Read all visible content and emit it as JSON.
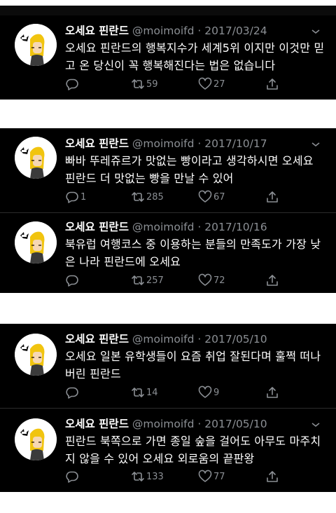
{
  "tweets": [
    {
      "name": "오세요 핀란드",
      "handle": "@moimoifd",
      "date": "· 2017/03/24",
      "text": "오세요 핀란드의 행복지수가 세계5위 이지만 이것만 믿고 온 당신이 꼭 행복해진다는 법은 없습니다",
      "replies": "",
      "retweets": "59",
      "likes": "27"
    },
    {
      "name": "오세요 핀란드",
      "handle": "@moimoifd",
      "date": "· 2017/10/17",
      "text": "빠바 뚜레쥬르가 맛없는 빵이라고 생각하시면 오세요 핀란드 더 맛없는 빵을 만날 수 있어",
      "replies": "1",
      "retweets": "285",
      "likes": "67"
    },
    {
      "name": "오세요 핀란드",
      "handle": "@moimoifd",
      "date": "· 2017/10/16",
      "text": "북유럽 여행코스 중 이용하는 분들의 만족도가 가장 낮은 나라 핀란드에 오세요",
      "replies": "",
      "retweets": "257",
      "likes": "72"
    },
    {
      "name": "오세요 핀란드",
      "handle": "@moimoifd",
      "date": "· 2017/05/10",
      "text": "오세요 일본 유학생들이 요즘 취업 잘된다며 훌쩍 떠나버린 핀란드",
      "replies": "",
      "retweets": "14",
      "likes": "9"
    },
    {
      "name": "오세요 핀란드",
      "handle": "@moimoifd",
      "date": "· 2017/05/10",
      "text": "핀란드 북쪽으로 가면 종일 숲을 걸어도 아무도 마주치지 않을 수 있어 오세요 외로움의 끝판왕",
      "replies": "",
      "retweets": "133",
      "likes": "77"
    }
  ],
  "icons": {
    "avatar": "blonde-character-avatar",
    "reply": "speech-bubble-icon",
    "retweet": "retweet-arrows-icon",
    "like": "heart-icon",
    "share": "share-upload-icon",
    "menu": "chevron-down-icon"
  },
  "colors": {
    "background": "#000000",
    "text": "#ffffff",
    "muted": "#8b8f94",
    "page": "#ffffff"
  }
}
